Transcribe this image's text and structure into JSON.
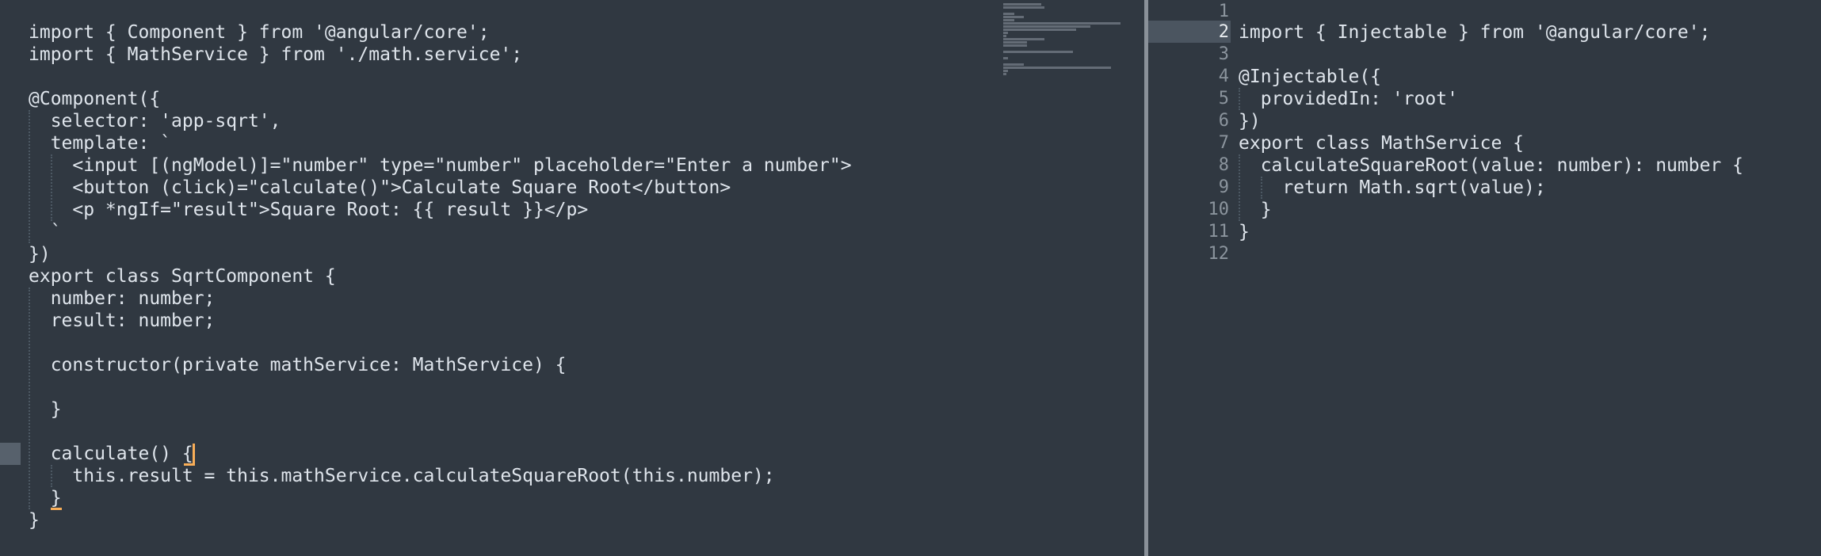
{
  "editor": {
    "left_pane": {
      "lines": [
        "import { Component } from '@angular/core';",
        "import { MathService } from './math.service';",
        "",
        "@Component({",
        "  selector: 'app-sqrt',",
        "  template: `",
        "    <input [(ngModel)]=\"number\" type=\"number\" placeholder=\"Enter a number\">",
        "    <button (click)=\"calculate()\">Calculate Square Root</button>",
        "    <p *ngIf=\"result\">Square Root: {{ result }}</p>",
        "  `",
        "})",
        "export class SqrtComponent {",
        "  number: number;",
        "  result: number;",
        "",
        "  constructor(private mathService: MathService) {",
        "",
        "  }",
        "",
        "  calculate() {",
        "    this.result = this.mathService.calculateSquareRoot(this.number);",
        "  }",
        "}"
      ]
    },
    "right_pane": {
      "current_line": 2,
      "lines": [
        "",
        "import { Injectable } from '@angular/core';",
        "",
        "@Injectable({",
        "  providedIn: 'root'",
        "})",
        "export class MathService {",
        "  calculateSquareRoot(value: number): number {",
        "    return Math.sqrt(value);",
        "  }",
        "}",
        ""
      ],
      "line_numbers": [
        "1",
        "2",
        "3",
        "4",
        "5",
        "6",
        "7",
        "8",
        "9",
        "10",
        "11",
        "12"
      ]
    },
    "colors": {
      "background": "#303841",
      "text": "#dfe5ec",
      "line_number": "#8b949d",
      "current_line_highlight": "#4b5560",
      "bracket_highlight": "#f9ae58",
      "indent_guide": "#4c5863"
    }
  }
}
